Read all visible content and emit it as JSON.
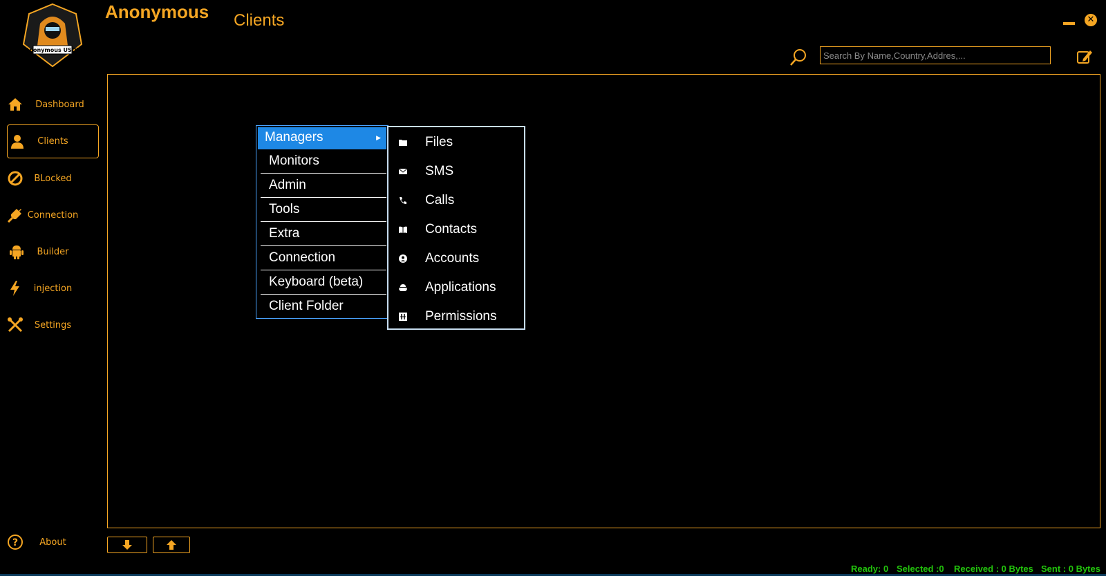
{
  "app": {
    "title": "Anonymous",
    "page_title": "Clients",
    "logo_text": "Anonymous USDT"
  },
  "search": {
    "placeholder": "Search By Name,Country,Addres,..."
  },
  "colors": {
    "accent": "#f5a623",
    "menu_highlight": "#1e88e5",
    "status": "#22c40c"
  },
  "sidebar": {
    "items": [
      {
        "label": "Dashboard",
        "icon": "home-icon"
      },
      {
        "label": "Clients",
        "icon": "user-icon",
        "active": true
      },
      {
        "label": "BLocked",
        "icon": "ban-icon"
      },
      {
        "label": "Connection",
        "icon": "plug-icon"
      },
      {
        "label": "Builder",
        "icon": "android-icon"
      },
      {
        "label": "injection",
        "icon": "bolt-icon"
      },
      {
        "label": "Settings",
        "icon": "tools-icon"
      }
    ],
    "about": {
      "label": "About",
      "icon": "question-icon"
    }
  },
  "context_menu": {
    "items": [
      {
        "label": "Managers"
      },
      {
        "label": "Monitors"
      },
      {
        "label": "Admin"
      },
      {
        "label": "Tools"
      },
      {
        "label": "Extra"
      },
      {
        "label": "Connection"
      },
      {
        "label": "Keyboard (beta)"
      },
      {
        "label": "Client Folder"
      }
    ]
  },
  "submenu": {
    "items": [
      {
        "label": "Files",
        "icon": "folder-icon"
      },
      {
        "label": "SMS",
        "icon": "envelope-icon"
      },
      {
        "label": "Calls",
        "icon": "phone-icon"
      },
      {
        "label": "Contacts",
        "icon": "book-icon"
      },
      {
        "label": "Accounts",
        "icon": "account-icon"
      },
      {
        "label": "Applications",
        "icon": "android-icon"
      },
      {
        "label": "Permissions",
        "icon": "grid-icon"
      }
    ]
  },
  "status_bar": {
    "ready": "Ready: 0",
    "selected": "Selected :0",
    "received": "Received : 0 Bytes",
    "sent": "Sent : 0 Bytes"
  }
}
